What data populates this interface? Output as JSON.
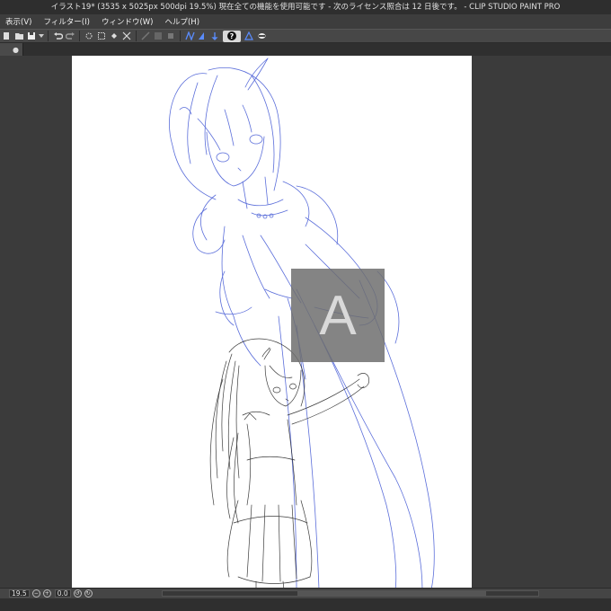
{
  "window": {
    "title": "イラスト19* (3535 x 5025px 500dpi 19.5%)  現在全ての機能を使用可能です - 次のライセンス照合は 12 日後です。 - CLIP STUDIO PAINT PRO"
  },
  "menubar": {
    "items": [
      "表示(V)",
      "フィルター(I)",
      "ウィンドウ(W)",
      "ヘルプ(H)"
    ]
  },
  "toolbar": {
    "icons": [
      "new-file-icon",
      "open-file-icon",
      "save-icon",
      "undo-icon",
      "redo-icon",
      "transform-icon",
      "select-all-icon",
      "fill-icon",
      "crop-icon",
      "snap-ruler-icon",
      "snap-grid-icon",
      "snap-special-icon",
      "help-icon",
      "ruler-tool-icon",
      "eraser-icon"
    ]
  },
  "tab": {
    "close_glyph": "●"
  },
  "canvas_overlay": {
    "letter": "A"
  },
  "statusbar": {
    "zoom": "19.5",
    "rotation": "0.0"
  },
  "colors": {
    "sketch_blue": "#4a5fd6",
    "sketch_black": "#1a1a1a",
    "overlay_gray": "#6e6e6e"
  }
}
